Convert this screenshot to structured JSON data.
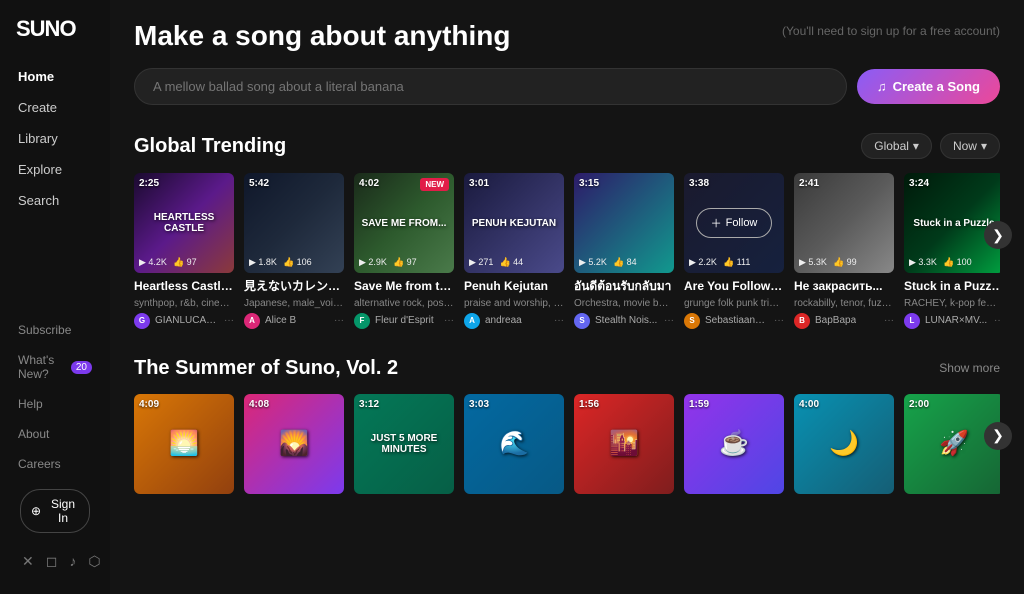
{
  "app": {
    "logo": "SUNO",
    "tagline": "Make a song about anything",
    "sub_note": "(You'll need to sign up for a free account)"
  },
  "sidebar": {
    "nav_items": [
      {
        "id": "home",
        "label": "Home",
        "active": true
      },
      {
        "id": "create",
        "label": "Create",
        "active": false
      },
      {
        "id": "library",
        "label": "Library",
        "active": false
      },
      {
        "id": "explore",
        "label": "Explore",
        "active": false
      },
      {
        "id": "search",
        "label": "Search",
        "active": false
      }
    ],
    "bottom_items": [
      {
        "id": "subscribe",
        "label": "Subscribe"
      },
      {
        "id": "whats-new",
        "label": "What's New?",
        "badge": "20"
      },
      {
        "id": "help",
        "label": "Help"
      },
      {
        "id": "about",
        "label": "About"
      },
      {
        "id": "careers",
        "label": "Careers"
      }
    ],
    "sign_in_label": "Sign In",
    "social": [
      "𝕏",
      "📷",
      "♪",
      "●"
    ]
  },
  "search_bar": {
    "placeholder": "A mellow ballad song about a literal banana",
    "create_button_label": "Create a Song"
  },
  "trending": {
    "section_title": "Global Trending",
    "filter_global": "Global",
    "filter_now": "Now",
    "cards": [
      {
        "id": "heartless-castle",
        "duration": "2:25",
        "title": "Heartless Castle 😎",
        "genre": "synthpop, r&b, cinematic...",
        "artist": "GIANLUCA_...",
        "plays": "4.2K",
        "likes": "97",
        "color": "t1",
        "label_text": "HEARTLESS CASTLE",
        "avatar_color": "#7c3aed",
        "avatar_letter": "G"
      },
      {
        "id": "mienai-calendar",
        "duration": "5:42",
        "title": "見えないカレンダー",
        "genre": "Japanese, male_voice, e...",
        "artist": "Alice B",
        "plays": "1.8K",
        "likes": "106",
        "color": "t2",
        "label_text": "",
        "avatar_color": "#db2777",
        "avatar_letter": "A"
      },
      {
        "id": "save-me-from-fall",
        "duration": "4:02",
        "title": "Save Me from the Fall",
        "genre": "alternative rock, post roc...",
        "artist": "Fleur d'Esprit",
        "plays": "2.9K",
        "likes": "97",
        "color": "t3",
        "label_text": "SAVE ME FROM...",
        "is_new": true,
        "avatar_color": "#059669",
        "avatar_letter": "F"
      },
      {
        "id": "penuh-kejutan",
        "duration": "3:01",
        "title": "Penuh Kejutan",
        "genre": "praise and worship, chris...",
        "artist": "andreaa",
        "plays": "271",
        "likes": "44",
        "color": "t4",
        "label_text": "PENUH KEJUTAN",
        "avatar_color": "#0ea5e9",
        "avatar_letter": "A"
      },
      {
        "id": "ton-ton",
        "duration": "3:15",
        "title": "อันดีต้อนรับกลับมา",
        "genre": "Orchestra, movie backgr...",
        "artist": "Stealth Nois...",
        "plays": "5.2K",
        "likes": "84",
        "color": "t5",
        "label_text": "",
        "avatar_color": "#6366f1",
        "avatar_letter": "S"
      },
      {
        "id": "are-you-following",
        "duration": "3:38",
        "title": "Are You Following?",
        "genre": "grunge folk punk triphop ...",
        "artist": "SebastiaanV...",
        "plays": "2.2K",
        "likes": "111",
        "color": "",
        "is_follow": true,
        "label_text": "",
        "avatar_color": "#d97706",
        "avatar_letter": "S"
      },
      {
        "id": "he-zakrasit",
        "duration": "2:41",
        "title": "Не закрасить...",
        "genre": "rockabilly, tenor, fuzz guit...",
        "artist": "BapBapa",
        "plays": "5.3K",
        "likes": "99",
        "color": "t7",
        "label_text": "",
        "avatar_color": "#dc2626",
        "avatar_letter": "B"
      },
      {
        "id": "stuck-in-puzzle",
        "duration": "3:24",
        "title": "Stuck in a Puzzle x...",
        "genre": "RACHEY, k-pop female v...",
        "artist": "LUNAR×MV...",
        "plays": "3.3K",
        "likes": "100",
        "color": "t8",
        "label_text": "Stuck in a Puzzle",
        "avatar_color": "#7c3aed",
        "avatar_letter": "L"
      }
    ]
  },
  "summer": {
    "section_title": "The Summer of Suno, Vol. 2",
    "show_more_label": "Show more",
    "cards": [
      {
        "id": "s1",
        "duration": "4:09",
        "color": "c1",
        "label_text": "🌅"
      },
      {
        "id": "s2",
        "duration": "4:08",
        "color": "c2",
        "label_text": "🌄"
      },
      {
        "id": "s3",
        "duration": "3:12",
        "color": "c3",
        "label_text": "JUST 5 MORE MINUTES"
      },
      {
        "id": "s4",
        "duration": "3:03",
        "color": "c4",
        "label_text": "🌊"
      },
      {
        "id": "s5",
        "duration": "1:56",
        "color": "c5",
        "label_text": "🌇"
      },
      {
        "id": "s6",
        "duration": "1:59",
        "color": "c6",
        "label_text": "☕"
      },
      {
        "id": "s7",
        "duration": "4:00",
        "color": "c7",
        "label_text": "🌙"
      },
      {
        "id": "s8",
        "duration": "2:00",
        "color": "c8",
        "label_text": "🚀"
      }
    ]
  }
}
